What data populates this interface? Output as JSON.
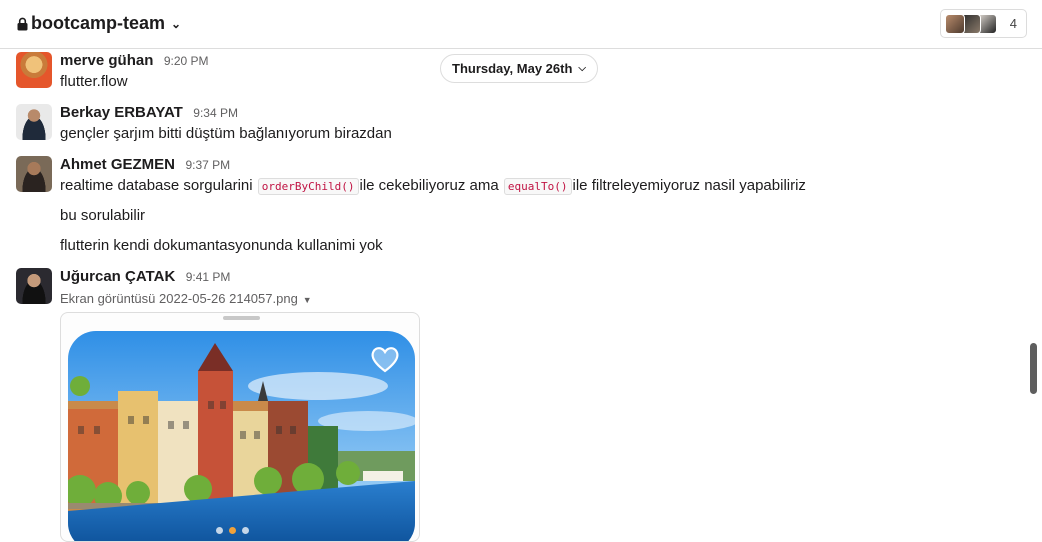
{
  "header": {
    "channel_name": "bootcamp-team",
    "member_count": "4",
    "lock_icon": "lock-icon",
    "chevron_icon": "chevron-down-icon"
  },
  "date_divider": {
    "label": "Thursday, May 26th"
  },
  "messages": [
    {
      "author": "merve gühan",
      "time": "9:20 PM",
      "lines": [
        "flutter.flow"
      ]
    },
    {
      "author": "Berkay ERBAYAT",
      "time": "9:34 PM",
      "lines": [
        "gençler şarjım bitti düştüm bağlanıyorum birazdan"
      ]
    },
    {
      "author": "Ahmet GEZMEN",
      "time": "9:37 PM",
      "rich_line": {
        "part1": "realtime database sorgularini",
        "code1": "orderByChild()",
        "part2": "ile cekebiliyoruz ama",
        "code2": "equalTo()",
        "part3": "ile filtreleyemiyoruz nasil yapabiliriz"
      },
      "lines": [
        "bu sorulabilir",
        "flutterin kendi dokumantasyonunda kullanimi yok"
      ]
    },
    {
      "author": "Uğurcan ÇATAK",
      "time": "9:41 PM",
      "file": {
        "name": "Ekran görüntüsü 2022-05-26 214057.png"
      }
    }
  ],
  "colors": {
    "text": "#1d1c1d",
    "muted": "#616061",
    "border": "#dddddd",
    "code_text": "#c01343",
    "accent_dot": "#f0a13a"
  },
  "icons": [
    "lock-icon",
    "chevron-down-icon",
    "caret-down-icon",
    "heart-icon"
  ]
}
